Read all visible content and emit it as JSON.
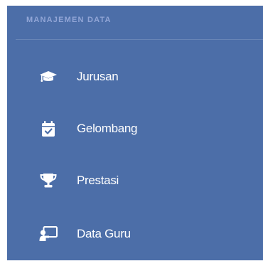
{
  "sidebar": {
    "section_title": "MANAJEMEN DATA",
    "items": [
      {
        "label": "Jurusan",
        "icon": "graduation-cap-icon"
      },
      {
        "label": "Gelombang",
        "icon": "calendar-check-icon"
      },
      {
        "label": "Prestasi",
        "icon": "trophy-icon"
      },
      {
        "label": "Data Guru",
        "icon": "chalkboard-teacher-icon"
      }
    ]
  },
  "colors": {
    "sidebar_bg": "#4c6ea8",
    "section_title": "#a9b8e6",
    "text": "#ffffff"
  }
}
